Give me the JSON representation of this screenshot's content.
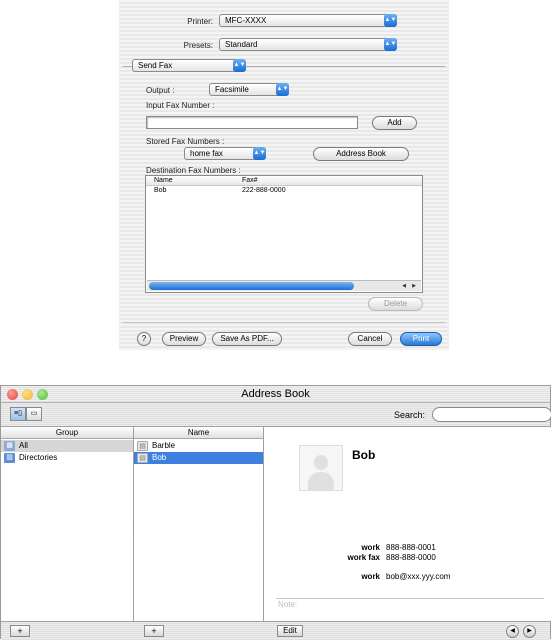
{
  "print_dialog": {
    "printer_label": "Printer:",
    "printer_value": "MFC-XXXX",
    "presets_label": "Presets:",
    "presets_value": "Standard",
    "panel_value": "Send Fax",
    "output_label": "Output :",
    "output_value": "Facsimile",
    "input_fax_label": "Input Fax Number :",
    "input_fax_value": "",
    "add_label": "Add",
    "stored_label": "Stored Fax Numbers :",
    "stored_value": "home fax",
    "address_book_label": "Address Book",
    "destination_label": "Destination Fax Numbers :",
    "table_headers": [
      "Name",
      "Fax#"
    ],
    "table_rows": [
      {
        "name": "Bob",
        "fax": "222-888-0000"
      }
    ],
    "delete_label": "Delete",
    "help_label": "?",
    "preview_label": "Preview",
    "save_pdf_label": "Save As PDF...",
    "cancel_label": "Cancel",
    "print_label": "Print"
  },
  "address_book": {
    "title": "Address Book",
    "search_label": "Search:",
    "search_value": "",
    "group_header": "Group",
    "groups": [
      "All",
      "Directories"
    ],
    "name_header": "Name",
    "names": [
      "Barble",
      "Bob"
    ],
    "card": {
      "name": "Bob",
      "fields": [
        {
          "label": "work",
          "value": "888-888-0001"
        },
        {
          "label": "work fax",
          "value": "888-888-0000"
        },
        {
          "label": "work",
          "value": "bob@xxx.yyy.com"
        }
      ],
      "note_label": "Note:"
    },
    "add_group_label": "+",
    "add_person_label": "+",
    "edit_label": "Edit"
  },
  "icons": [
    "help-icon",
    "popup-arrow-icon",
    "group-icon",
    "person-card-icon",
    "photo-placeholder-icon",
    "back-arrow-icon",
    "forward-arrow-icon"
  ],
  "colors": {
    "accent": "#3d80df",
    "close": "#e0443e",
    "minimize": "#f0b030",
    "zoom": "#4fbf3a"
  }
}
